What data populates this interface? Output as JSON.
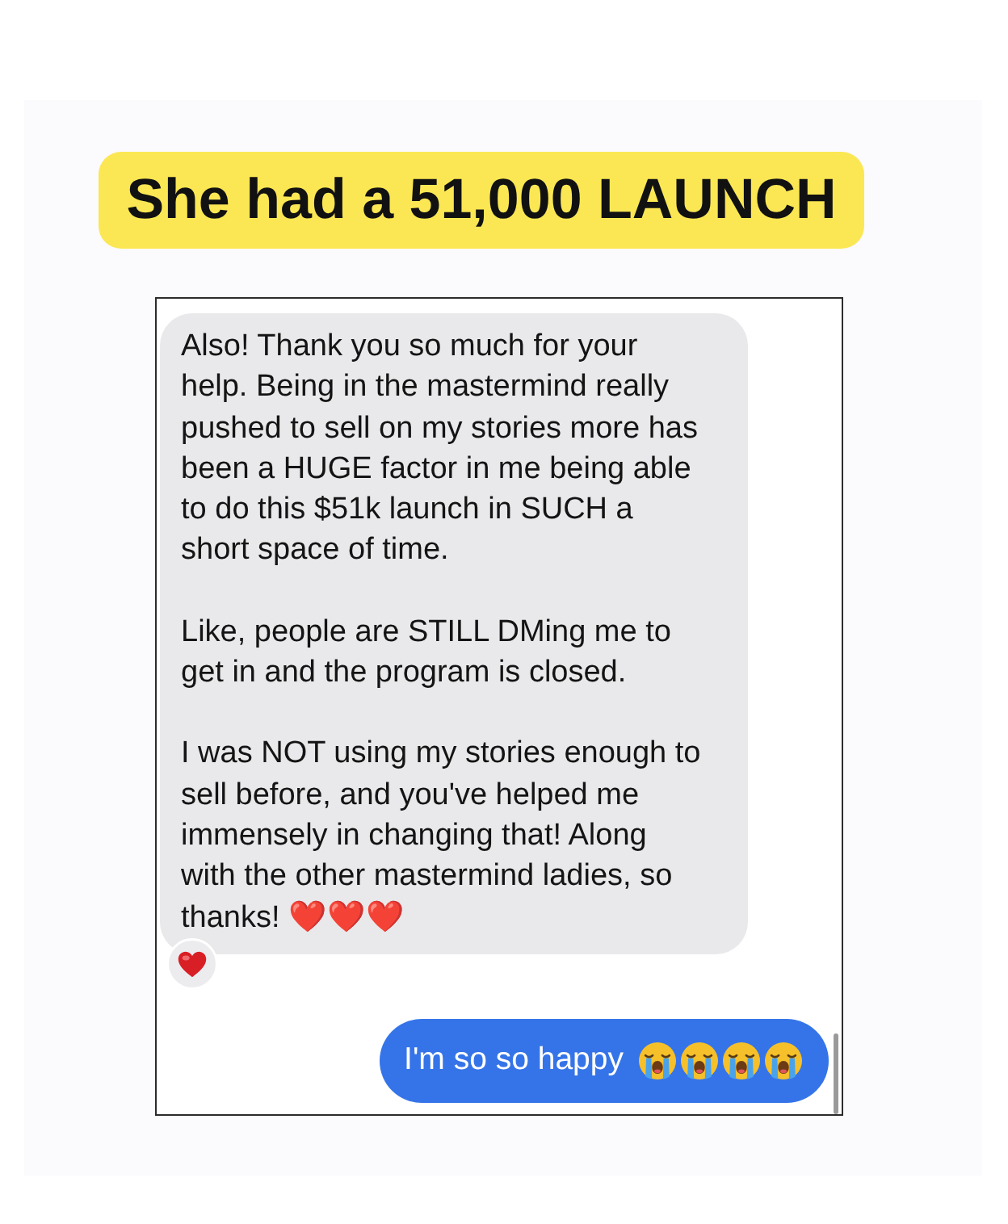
{
  "headline": {
    "text": "She had a 51,000 LAUNCH"
  },
  "chat": {
    "messages": [
      {
        "kind": "received",
        "paragraphs": [
          "Also! Thank you so much for your help. Being in the mastermind really pushed to sell on my stories more has been a HUGE factor in me being able to do this $51k launch in SUCH a short space of time.",
          "Like, people are STILL DMing me to get in and the program is closed.",
          "I was NOT using my stories enough to sell before, and you've helped me immensely in changing that! Along with the other mastermind ladies, so thanks! ❤️❤️❤️"
        ],
        "reaction": {
          "kind": "heart"
        }
      },
      {
        "kind": "sent",
        "paragraphs": [
          "I'm so so happy"
        ],
        "trailing_emojis": [
          {
            "kind": "crying"
          },
          {
            "kind": "crying"
          },
          {
            "kind": "crying"
          },
          {
            "kind": "crying"
          }
        ]
      }
    ]
  }
}
